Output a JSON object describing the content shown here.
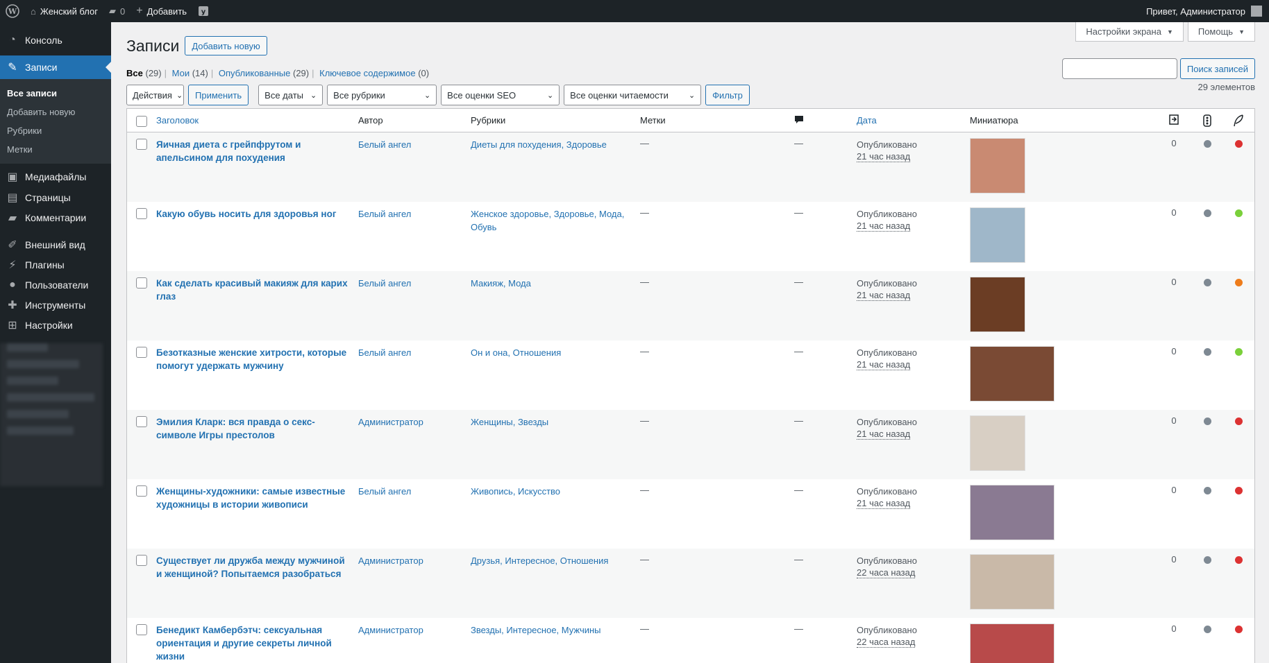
{
  "adminbar": {
    "site_name": "Женский блог",
    "comments_count": "0",
    "new_label": "Добавить",
    "greeting": "Привет, Администратор"
  },
  "sidebar": {
    "items": [
      {
        "label": "Консоль",
        "icon": "dashboard-icon"
      },
      {
        "label": "Записи",
        "icon": "pin-icon"
      },
      {
        "label": "Медиафайлы",
        "icon": "media-icon"
      },
      {
        "label": "Страницы",
        "icon": "page-icon"
      },
      {
        "label": "Комментарии",
        "icon": "comment-icon"
      },
      {
        "label": "Внешний вид",
        "icon": "brush-icon"
      },
      {
        "label": "Плагины",
        "icon": "plugin-icon"
      },
      {
        "label": "Пользователи",
        "icon": "users-icon"
      },
      {
        "label": "Инструменты",
        "icon": "wrench-icon"
      },
      {
        "label": "Настройки",
        "icon": "settings-icon"
      }
    ],
    "submenu": [
      "Все записи",
      "Добавить новую",
      "Рубрики",
      "Метки"
    ]
  },
  "screen_meta": {
    "options": "Настройки экрана",
    "help": "Помощь"
  },
  "page": {
    "title": "Записи",
    "add_new": "Добавить новую"
  },
  "views": [
    {
      "label": "Все",
      "count": "(29)"
    },
    {
      "label": "Мои",
      "count": "(14)"
    },
    {
      "label": "Опубликованные",
      "count": "(29)"
    },
    {
      "label": "Ключевое содержимое",
      "count": "(0)"
    }
  ],
  "search": {
    "button": "Поиск записей"
  },
  "tablenav": {
    "bulk": "Действия",
    "apply": "Применить",
    "dates": "Все даты",
    "cats": "Все рубрики",
    "seo": "Все оценки SEO",
    "readability": "Все оценки читаемости",
    "filter": "Фильтр",
    "count": "29 элементов"
  },
  "columns": {
    "title": "Заголовок",
    "author": "Автор",
    "categories": "Рубрики",
    "tags": "Метки",
    "date": "Дата",
    "thumbnail": "Миниатюра"
  },
  "colors": {
    "accent": "#2271b1",
    "gray_dot": "#7e8993",
    "red": "#dc3232",
    "green": "#7ad03a",
    "orange": "#ee7c1b"
  },
  "posts": [
    {
      "title": "Яичная диета с грейпфрутом и апельсином для похудения",
      "author": "Белый ангел",
      "cats": "Диеты для похудения, Здоровье",
      "tags": "—",
      "comments": "—",
      "status": "Опубликовано",
      "ago": "21 час назад",
      "links": "0",
      "seo": "#dc3232",
      "thumb_wide": false,
      "thumb_color": "#c98a72"
    },
    {
      "title": "Какую обувь носить для здоровья ног",
      "author": "Белый ангел",
      "cats": "Женское здоровье, Здоровье, Мода, Обувь",
      "tags": "—",
      "comments": "—",
      "status": "Опубликовано",
      "ago": "21 час назад",
      "links": "0",
      "seo": "#7ad03a",
      "thumb_wide": false,
      "thumb_color": "#9fb7c9"
    },
    {
      "title": "Как сделать красивый макияж для карих глаз",
      "author": "Белый ангел",
      "cats": "Макияж, Мода",
      "tags": "—",
      "comments": "—",
      "status": "Опубликовано",
      "ago": "21 час назад",
      "links": "0",
      "seo": "#ee7c1b",
      "thumb_wide": false,
      "thumb_color": "#6b3d24"
    },
    {
      "title": "Безотказные женские хитрости, которые помогут удержать мужчину",
      "author": "Белый ангел",
      "cats": "Он и она, Отношения",
      "tags": "—",
      "comments": "—",
      "status": "Опубликовано",
      "ago": "21 час назад",
      "links": "0",
      "seo": "#7ad03a",
      "thumb_wide": true,
      "thumb_color": "#7a4a34"
    },
    {
      "title": "Эмилия Кларк: вся правда о секс-символе Игры престолов",
      "author": "Администратор",
      "cats": "Женщины, Звезды",
      "tags": "—",
      "comments": "—",
      "status": "Опубликовано",
      "ago": "21 час назад",
      "links": "0",
      "seo": "#dc3232",
      "thumb_wide": false,
      "thumb_color": "#d8cfc4"
    },
    {
      "title": "Женщины-художники: самые известные художницы в истории живописи",
      "author": "Белый ангел",
      "cats": "Живопись, Искусство",
      "tags": "—",
      "comments": "—",
      "status": "Опубликовано",
      "ago": "21 час назад",
      "links": "0",
      "seo": "#dc3232",
      "thumb_wide": true,
      "thumb_color": "#8a7a92"
    },
    {
      "title": "Существует ли дружба между мужчиной и женщиной? Попытаемся разобраться",
      "author": "Администратор",
      "cats": "Друзья, Интересное, Отношения",
      "tags": "—",
      "comments": "—",
      "status": "Опубликовано",
      "ago": "22 часа назад",
      "links": "0",
      "seo": "#dc3232",
      "thumb_wide": true,
      "thumb_color": "#c9b9a8"
    },
    {
      "title": "Бенедикт Камбербэтч: сексуальная ориентация и другие секреты личной жизни",
      "author": "Администратор",
      "cats": "Звезды, Интересное, Мужчины",
      "tags": "—",
      "comments": "—",
      "status": "Опубликовано",
      "ago": "22 часа назад",
      "links": "0",
      "seo": "#dc3232",
      "thumb_wide": true,
      "thumb_color": "#b84a4a"
    }
  ]
}
